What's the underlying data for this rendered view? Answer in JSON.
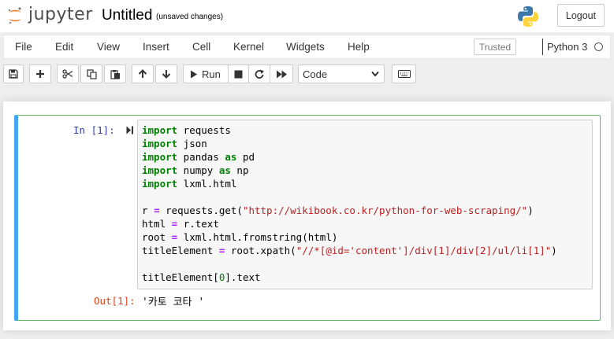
{
  "header": {
    "logo_text": "jupyter",
    "notebook_title": "Untitled",
    "save_status": "(unsaved changes)",
    "logout_label": "Logout"
  },
  "menubar": {
    "items": [
      "File",
      "Edit",
      "View",
      "Insert",
      "Cell",
      "Kernel",
      "Widgets",
      "Help"
    ],
    "trusted_label": "Trusted",
    "kernel_name": "Python 3"
  },
  "toolbar": {
    "run_label": "Run",
    "cell_type": "Code",
    "icons": [
      "save-icon",
      "add-icon",
      "cut-icon",
      "copy-icon",
      "paste-icon",
      "move-up-icon",
      "move-down-icon",
      "run-icon",
      "interrupt-icon",
      "restart-icon",
      "fast-forward-icon",
      "keyboard-icon"
    ]
  },
  "cell": {
    "in_prompt": "In [1]:",
    "code_lines": [
      [
        {
          "t": "import",
          "c": "kw"
        },
        {
          "t": " requests"
        }
      ],
      [
        {
          "t": "import",
          "c": "kw"
        },
        {
          "t": " json"
        }
      ],
      [
        {
          "t": "import",
          "c": "kw"
        },
        {
          "t": " pandas "
        },
        {
          "t": "as",
          "c": "kw"
        },
        {
          "t": " pd"
        }
      ],
      [
        {
          "t": "import",
          "c": "kw"
        },
        {
          "t": " numpy "
        },
        {
          "t": "as",
          "c": "kw"
        },
        {
          "t": " np"
        }
      ],
      [
        {
          "t": "import",
          "c": "kw"
        },
        {
          "t": " lxml.html"
        }
      ],
      [],
      [
        {
          "t": "r "
        },
        {
          "t": "=",
          "c": "op"
        },
        {
          "t": " requests.get("
        },
        {
          "t": "\"http://wikibook.co.kr/python-for-web-scraping/\"",
          "c": "str"
        },
        {
          "t": ")"
        }
      ],
      [
        {
          "t": "html "
        },
        {
          "t": "=",
          "c": "op"
        },
        {
          "t": " r.text"
        }
      ],
      [
        {
          "t": "root "
        },
        {
          "t": "=",
          "c": "op"
        },
        {
          "t": " lxml.html.fromstring(html)"
        }
      ],
      [
        {
          "t": "titleElement "
        },
        {
          "t": "=",
          "c": "op"
        },
        {
          "t": " root.xpath("
        },
        {
          "t": "\"//*[@id='content']/div[1]/div[2]/ul/li[1]\"",
          "c": "str"
        },
        {
          "t": ")"
        }
      ],
      [],
      [
        {
          "t": "titleElement["
        },
        {
          "t": "0",
          "c": "num"
        },
        {
          "t": "].text"
        }
      ]
    ],
    "out_prompt": "Out[1]:",
    "output_text": "'카토 코타 '"
  },
  "colors": {
    "cell_left_border": "#42a5f5",
    "cell_border": "#66bb6a",
    "in_prompt": "#303f9f",
    "out_prompt": "#d84315",
    "keyword": "#008000",
    "string": "#ba2121"
  }
}
